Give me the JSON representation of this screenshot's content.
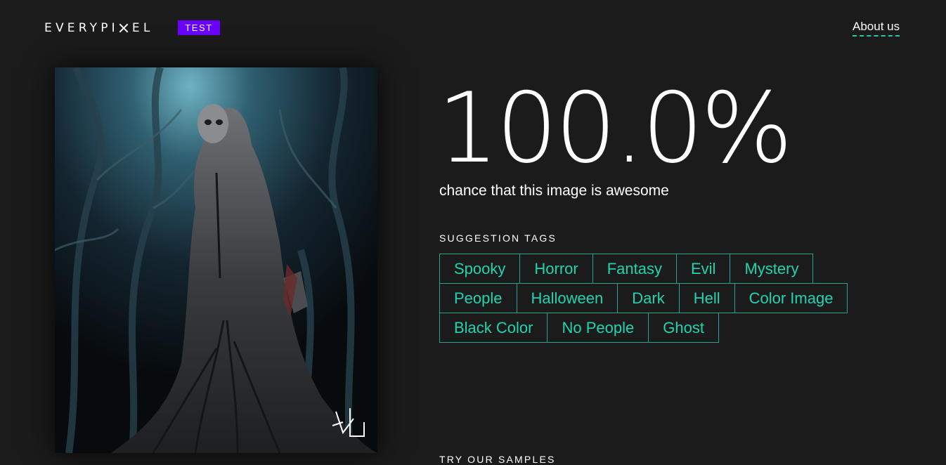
{
  "header": {
    "logo_left": "EVERYPI",
    "logo_right": "EL",
    "badge": "TEST",
    "about_link": "About us"
  },
  "result": {
    "score": "100.0%",
    "caption": "chance that this image is awesome"
  },
  "tags_section": {
    "label": "SUGGESTION TAGS",
    "rows": [
      [
        "Spooky",
        "Horror",
        "Fantasy",
        "Evil",
        "Mystery"
      ],
      [
        "People",
        "Halloween",
        "Dark",
        "Hell",
        "Color Image"
      ],
      [
        "Black Color",
        "No People",
        "Ghost"
      ]
    ]
  },
  "samples_section": {
    "label": "TRY OUR SAMPLES"
  },
  "colors": {
    "background": "#1b1b1b",
    "accent_purple": "#6a00ff",
    "tag_text": "#21d4b0",
    "tag_border": "#1fa58c",
    "link_underline": "#20c9a6"
  },
  "icons": {
    "logo_mark": "x-mark-icon"
  }
}
